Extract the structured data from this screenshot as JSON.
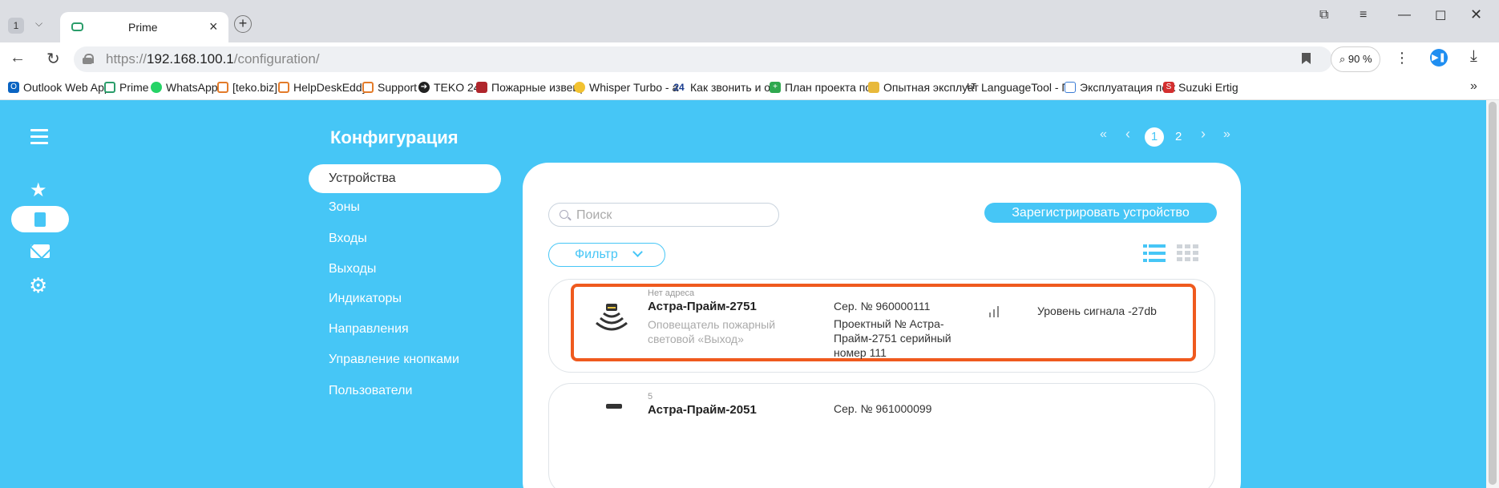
{
  "browser": {
    "tab_counter": "1",
    "tab_title": "Prime",
    "url_prefix": "https://",
    "url_host": "192.168.100.1",
    "url_path": "/configuration/",
    "zoom": "90 %",
    "extension_icon": "▶❚",
    "bookmarks": [
      {
        "label": "Outlook Web App",
        "icon": "outlook-icon",
        "color": "#0a64c2"
      },
      {
        "label": "Prime",
        "icon": "prime-icon",
        "color": "#2a9d6a"
      },
      {
        "label": "WhatsApp",
        "icon": "whatsapp-icon",
        "color": "#25d366"
      },
      {
        "label": "[teko.biz]",
        "icon": "teko-icon",
        "color": "#e37b2a"
      },
      {
        "label": "HelpDeskEddy",
        "icon": "helpdesk-icon",
        "color": "#e37b2a"
      },
      {
        "label": "Support",
        "icon": "support-icon",
        "color": "#e37b2a"
      },
      {
        "label": "TEKO 24",
        "icon": "teko24-icon",
        "color": "#222222"
      },
      {
        "label": "Пожарные извещ",
        "icon": "fire-icon",
        "color": "#b0262c"
      },
      {
        "label": "Whisper Turbo - a",
        "icon": "whisper-icon",
        "color": "#f2c230"
      },
      {
        "label": "Как звонить и отв",
        "icon": "call-icon",
        "color": "#1a3d8f"
      },
      {
        "label": "План проекта по",
        "icon": "plan-icon",
        "color": "#2fa84f"
      },
      {
        "label": "Опытная эксплуат",
        "icon": "folder-icon",
        "color": "#e8b93a"
      },
      {
        "label": "LanguageTool - П",
        "icon": "languagetool-icon",
        "color": "#333333"
      },
      {
        "label": "Эксплуатация пож",
        "icon": "doc-icon",
        "color": "#3a7bd5"
      },
      {
        "label": "Suzuki Ertig",
        "icon": "suzuki-icon",
        "color": "#d32f2f"
      }
    ],
    "bookmarks_more": "»"
  },
  "app": {
    "page_title": "Конфигурация",
    "pagination": {
      "first": "«",
      "prev": "‹",
      "current": "1",
      "next_page": "2",
      "next": "›",
      "last": "»"
    },
    "nav": [
      {
        "label": "Устройства",
        "active": true
      },
      {
        "label": "Зоны"
      },
      {
        "label": "Входы"
      },
      {
        "label": "Выходы"
      },
      {
        "label": "Индикаторы"
      },
      {
        "label": "Направления"
      },
      {
        "label": "Управление кнопками"
      },
      {
        "label": "Пользователи"
      }
    ],
    "search_placeholder": "Поиск",
    "register_button": "Зарегистрировать устройство",
    "filter_button": "Фильтр",
    "devices": [
      {
        "address": "Нет адреса",
        "name": "Астра-Прайм-2751",
        "type_line1": "Оповещатель пожарный",
        "type_line2": "световой «Выход»",
        "serial": "Сер. № 960000111",
        "project_line1": "Проектный № Астра-",
        "project_line2": "Прайм-2751 серийный",
        "project_line3": "номер 111",
        "signal": "Уровень сигнала -27db",
        "highlighted": true
      },
      {
        "address": "5",
        "name": "Астра-Прайм-2051",
        "serial": "Сер. № 961000099"
      }
    ]
  },
  "colors": {
    "accent": "#46c6f6",
    "highlight": "#ef5a1e"
  }
}
